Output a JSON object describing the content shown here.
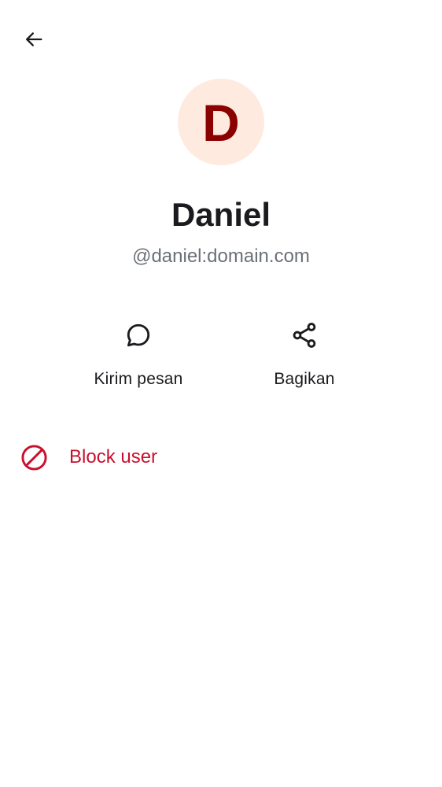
{
  "profile": {
    "avatar_initial": "D",
    "display_name": "Daniel",
    "user_id": "@daniel:domain.com"
  },
  "actions": {
    "send_message_label": "Kirim pesan",
    "share_label": "Bagikan"
  },
  "danger": {
    "block_label": "Block user"
  },
  "icons": {
    "back": "arrow-back-icon",
    "message": "chat-bubble-icon",
    "share": "share-icon",
    "block": "block-icon"
  },
  "colors": {
    "avatar_background": "#ffeae0",
    "avatar_letter": "#8b0000",
    "danger": "#c8102e",
    "secondary_text": "#6b7076"
  }
}
